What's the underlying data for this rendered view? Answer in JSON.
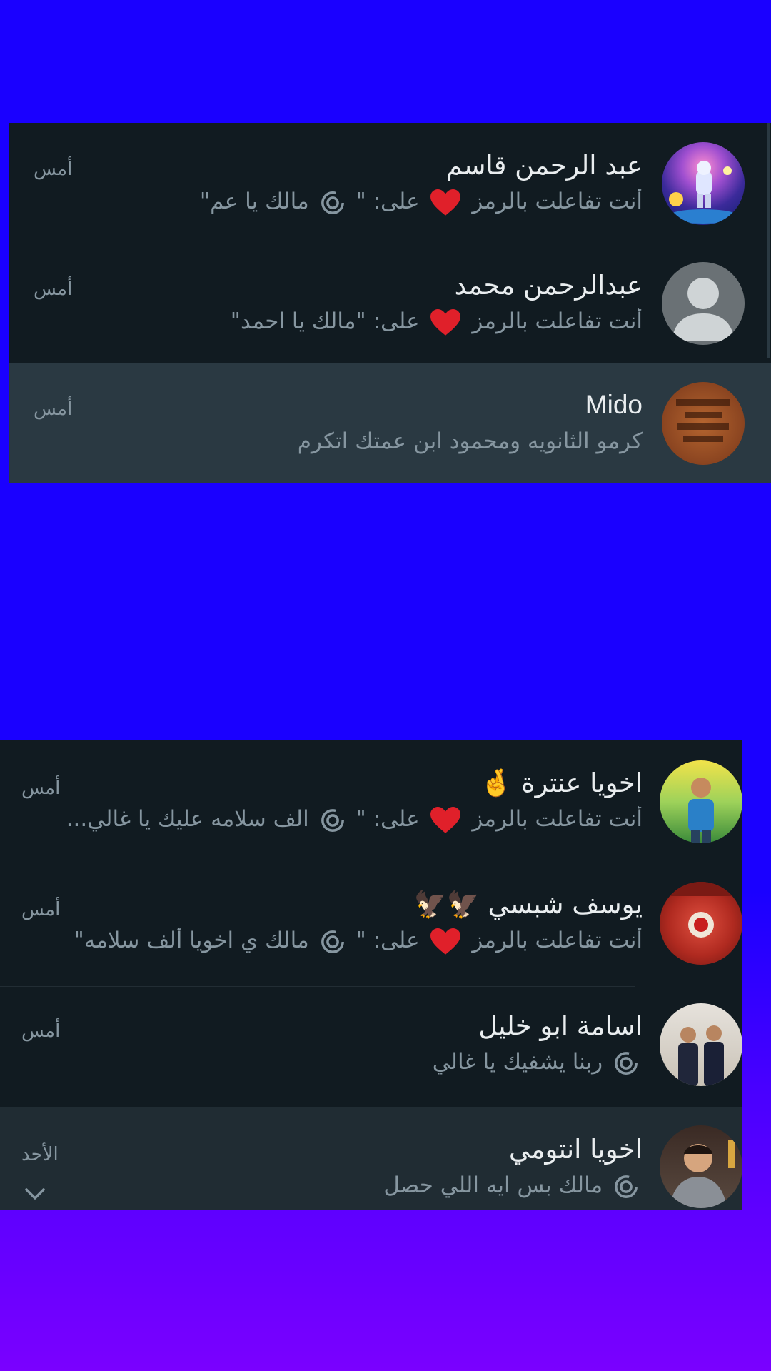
{
  "top_list": [
    {
      "name": "عبد الرحمن قاسم",
      "preview_prefix": "أنت تفاعلت بالرمز",
      "preview_suffix": "على: \"",
      "preview_quote": "مالك يا عم\"",
      "time": "أمس",
      "avatar": "astronaut-photo"
    },
    {
      "name": "عبدالرحمن محمد",
      "preview_prefix": "أنت تفاعلت بالرمز",
      "preview_suffix": "على: \"مالك يا احمد\"",
      "time": "أمس",
      "avatar": "default-person"
    },
    {
      "name": "Mido",
      "preview": "كرمو الثانويه ومحمود ابن عمتك اتكرم",
      "time": "أمس",
      "avatar": "wood-sign-photo"
    }
  ],
  "bottom_list": [
    {
      "name": "اخويا عنترة",
      "name_emoji": "🤞",
      "preview_prefix": "أنت تفاعلت بالرمز",
      "preview_suffix": "على: \"",
      "preview_quote": "الف سلامه عليك يا غالي...",
      "time": "أمس",
      "avatar": "boy-field-photo"
    },
    {
      "name": "يوسف شبسي",
      "name_emoji": "🦅🦅",
      "preview_prefix": "أنت تفاعلت بالرمز",
      "preview_suffix": "على: \"",
      "preview_quote": "مالك ي اخويا ألف سلامه\"",
      "time": "أمس",
      "avatar": "stadium-crowd-photo"
    },
    {
      "name": "اسامة ابو خليل",
      "preview": "ربنا يشفيك يا غالي",
      "time": "أمس",
      "avatar": "two-men-suits-photo"
    },
    {
      "name": "اخويا انتومي",
      "preview": "مالك بس ايه اللي حصل",
      "time": "الأحد",
      "avatar": "man-portrait-photo"
    }
  ],
  "colors": {
    "panel_bg": "#111b21",
    "selected_bg": "#2a3942",
    "hover_bg": "#202c33",
    "name_text": "#e9edef",
    "secondary_text": "#8696a0",
    "heart": "#e0202a",
    "page_bg": "#1a00ff"
  }
}
